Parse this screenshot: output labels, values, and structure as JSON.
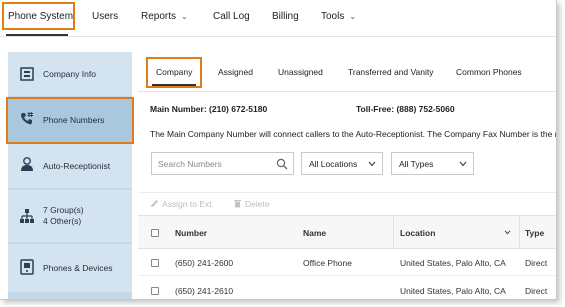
{
  "topnav": {
    "items": [
      {
        "label": "Phone System",
        "active": true
      },
      {
        "label": "Users"
      },
      {
        "label": "Reports",
        "has_caret": true
      },
      {
        "label": "Call Log"
      },
      {
        "label": "Billing"
      },
      {
        "label": "Tools",
        "has_caret": true
      }
    ]
  },
  "sidebar": {
    "items": [
      {
        "label": "Company Info",
        "icon": "building-icon"
      },
      {
        "label": "Phone Numbers",
        "icon": "phone-hash-icon",
        "active": true
      },
      {
        "label": "Auto-Receptionist",
        "icon": "receptionist-icon"
      },
      {
        "label_line1": "7 Group(s)",
        "label_line2": "4 Other(s)",
        "icon": "org-chart-icon"
      },
      {
        "label": "Phones & Devices",
        "icon": "device-icon"
      }
    ]
  },
  "tabs": [
    {
      "label": "Company",
      "active": true
    },
    {
      "label": "Assigned"
    },
    {
      "label": "Unassigned"
    },
    {
      "label": "Transferred and Vanity"
    },
    {
      "label": "Common Phones"
    }
  ],
  "info": {
    "main_label": "Main Number:",
    "main_value": "(210) 672-5180",
    "tollfree_label": "Toll-Free:",
    "tollfree_value": "(888) 752-5060",
    "description": "The Main Company Number will connect callers to the Auto-Receptionist. The Company Fax Number is the m"
  },
  "filters": {
    "search_placeholder": "Search Numbers",
    "location_value": "All Locations",
    "type_value": "All Types"
  },
  "actions": {
    "assign_label": "Assign to Ext.",
    "delete_label": "Delete"
  },
  "table": {
    "headers": {
      "number": "Number",
      "name": "Name",
      "location": "Location",
      "type": "Type"
    },
    "rows": [
      {
        "number": "(650) 241-2600",
        "name": "Office Phone",
        "location": "United States, Palo Alto, CA",
        "type": "Direct"
      },
      {
        "number": "(650) 241-2610",
        "name": "",
        "location": "United States, Palo Alto, CA",
        "type": "Direct"
      }
    ]
  },
  "colors": {
    "highlight": "#e07b1a",
    "sidebar_bg": "#c5d9e8",
    "sidebar_active": "#a9c7dd",
    "icon_color": "#2b3f55"
  }
}
